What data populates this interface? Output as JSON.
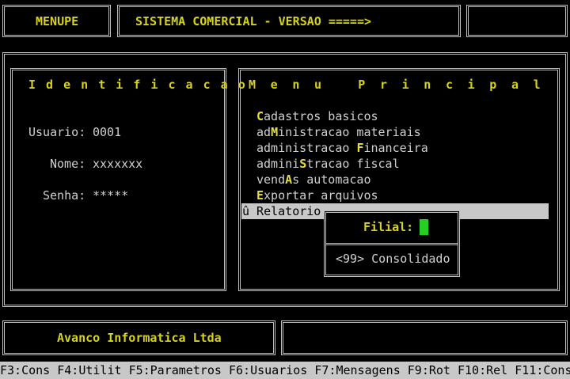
{
  "header": {
    "program": "MENUPE",
    "system_title": "SISTEMA COMERCIAL - VERSAO =====>",
    "version": ""
  },
  "identification": {
    "title": "I d e n t i f i c a c a o",
    "user_label": "Usuario:",
    "user_value": "0001",
    "name_label": "Nome:",
    "name_value": "xxxxxxx",
    "password_label": "Senha:",
    "password_value": "*****"
  },
  "menu": {
    "title": "M e n u   P r i n c i p a l",
    "items": [
      {
        "pre": "",
        "hot": "C",
        "post": "adastros basicos"
      },
      {
        "pre": "ad",
        "hot": "M",
        "post": "inistracao materiais"
      },
      {
        "pre": "administracao ",
        "hot": "F",
        "post": "inanceira"
      },
      {
        "pre": "admini",
        "hot": "S",
        "post": "tracao fiscal"
      },
      {
        "pre": "vend",
        "hot": "A",
        "post": "s automacao"
      },
      {
        "pre": "",
        "hot": "E",
        "post": "xportar arquivos"
      }
    ],
    "selected_label": "û Relatorio"
  },
  "popup": {
    "filial_label": "Filial:",
    "consolidated_option": "<99> Consolidado"
  },
  "footer": {
    "company": "Avanco Informatica Ltda",
    "status": ""
  },
  "function_keys": [
    "F3:Cons",
    "F4:Utilit",
    "F5:Parametros",
    "F6:Usuarios",
    "F7:Mensagens",
    "F9:Rot",
    "F10:Rel",
    "F11:Cons"
  ],
  "colors": {
    "accent": "#d7d21e",
    "cursor": "#22d022",
    "highlight_bar": "#c8c8c8",
    "background": "#000000"
  }
}
